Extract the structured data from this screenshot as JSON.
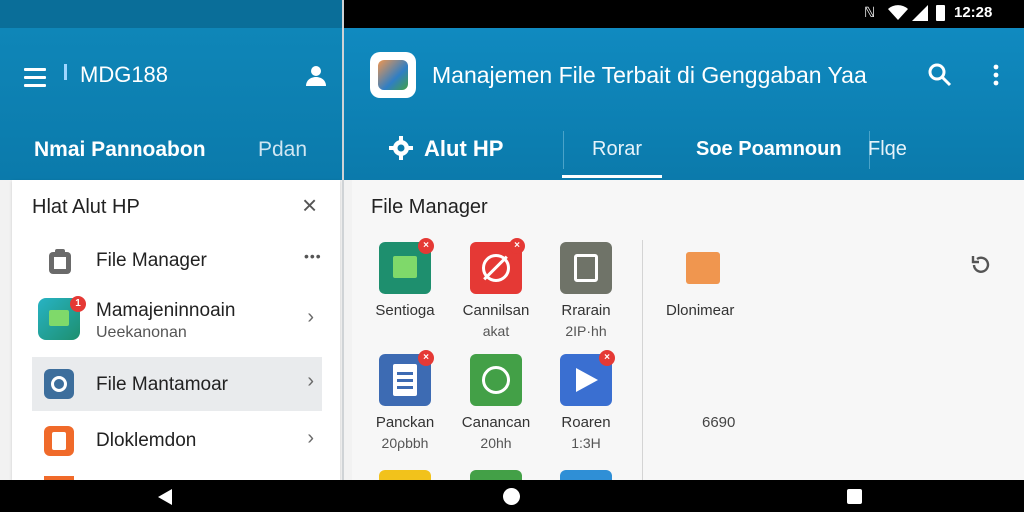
{
  "status_bar": {
    "time": "12:28",
    "icons": [
      "nfc-icon",
      "wifi-icon",
      "signal-icon",
      "battery-icon"
    ]
  },
  "left": {
    "app_title": "MDG188",
    "tabs": [
      "Nmai Pannoabon",
      "Pdan"
    ],
    "panel": {
      "title": "Hlat Alut HP",
      "items": [
        {
          "label": "File Manager",
          "icon": "clipboard-icon",
          "trailing": "•••"
        },
        {
          "label": "Mamajeninnoain",
          "sub": "Ueekanonan",
          "icon": "chat-icon",
          "badge": "1",
          "trailing": "›"
        },
        {
          "label": "File Mantamoar",
          "icon": "gear-icon",
          "trailing": "›",
          "selected": true
        },
        {
          "label": "Dloklemdon",
          "icon": "document-icon",
          "trailing": "›"
        }
      ]
    }
  },
  "right": {
    "app_title": "Manajemen File Terbait di Genggaban Yaa",
    "tabs": [
      "Alut HP",
      "Rorar",
      "Soe Poamnoun",
      "Flqe"
    ],
    "section_title": "File Manager",
    "apps": [
      {
        "label": "Sentioga",
        "sub": "",
        "color": "#1e8f6e",
        "icon": "calendar-icon",
        "badge": "x"
      },
      {
        "label": "Cannilsan",
        "sub": "akat",
        "color": "#e53935",
        "icon": "block-icon",
        "badge": "x"
      },
      {
        "label": "Rrarain",
        "sub": "2IP·hh",
        "color": "#6f7368",
        "icon": "file-icon",
        "badge": ""
      },
      {
        "label": "Panckan",
        "sub": "20ρbbh",
        "color": "#3d6bb3",
        "icon": "list-icon",
        "badge": "x"
      },
      {
        "label": "Canancan",
        "sub": "20hh",
        "color": "#43a047",
        "icon": "whatsapp-icon",
        "badge": ""
      },
      {
        "label": "Roaren",
        "sub": "1:3H",
        "color": "#3a6fd1",
        "icon": "play-icon",
        "badge": "x"
      }
    ],
    "side": {
      "label": "Dlonimear",
      "value": "6690"
    }
  },
  "colors": {
    "appbar": "#0b7aab",
    "accent_orange": "#f0964f",
    "badge": "#e53935"
  }
}
